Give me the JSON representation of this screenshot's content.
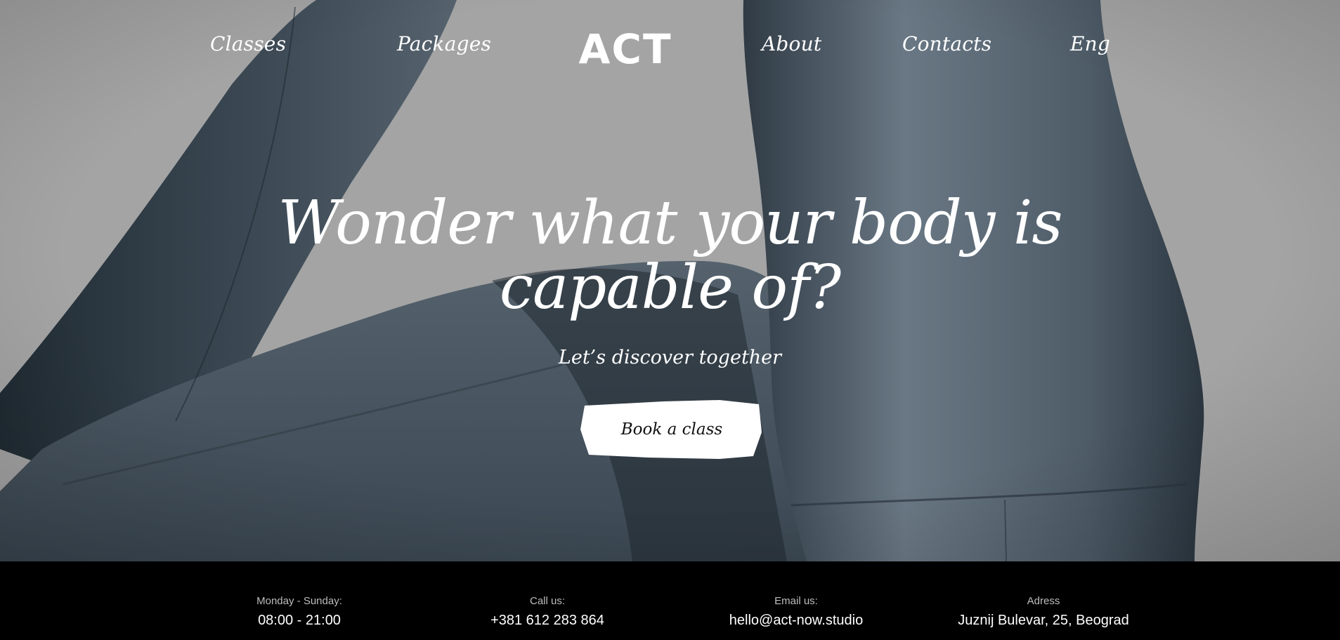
{
  "nav": {
    "left": [
      "Classes",
      "Packages"
    ],
    "logo_text": "ACT",
    "right": [
      "About",
      "Contacts",
      "Eng"
    ]
  },
  "hero": {
    "headline_line1": "Wonder what your body is",
    "headline_line2": "capable of?",
    "subline": "Let’s discover together",
    "cta_label": "Book a class"
  },
  "footer": {
    "items": [
      {
        "label": "Monday - Sunday:",
        "value": "08:00 - 21:00"
      },
      {
        "label": "Call us:",
        "value": "+381 612 283 864"
      },
      {
        "label": "Email us:",
        "value": "hello@act-now.studio"
      },
      {
        "label": "Adress",
        "value": "Juznij Bulevar, 25, Beograd"
      }
    ]
  },
  "colors": {
    "background_gray": "#a3a3a3",
    "fabric_dark": "#46535f",
    "fabric_light": "#6b7886",
    "footer": "#000000",
    "text": "#ffffff"
  }
}
